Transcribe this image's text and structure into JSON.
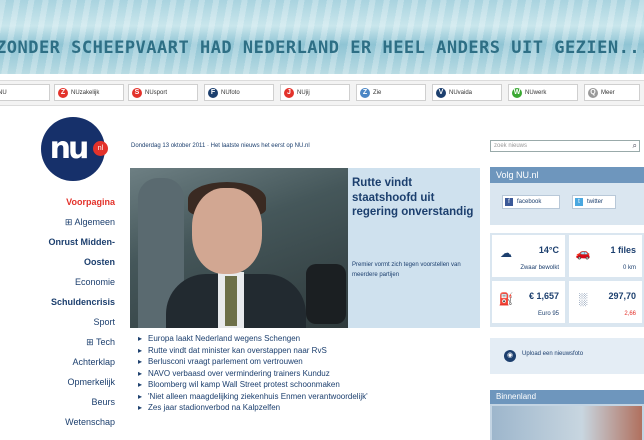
{
  "banner": {
    "text": "ZONDER SCHEEPVAART HAD NEDERLAND ER HEEL ANDERS UIT GEZIEN..."
  },
  "nav": {
    "tabs": [
      {
        "label": "NU",
        "icon": "",
        "color": ""
      },
      {
        "label": "NUzakelijk",
        "icon": "Z",
        "color": "#e3322b"
      },
      {
        "label": "NUsport",
        "icon": "S",
        "color": "#e3322b"
      },
      {
        "label": "NUfoto",
        "icon": "F",
        "color": "#1c3f6e"
      },
      {
        "label": "NUjij",
        "icon": "J",
        "color": "#e3322b"
      },
      {
        "label": "Zie",
        "icon": "Z",
        "color": "#4a86c5"
      },
      {
        "label": "NUvaida",
        "icon": "V",
        "color": "#1c3f6e"
      },
      {
        "label": "NUwerk",
        "icon": "W",
        "color": "#3aa832"
      },
      {
        "label": "Meer",
        "icon": "Q",
        "color": "#999999"
      }
    ]
  },
  "logo": {
    "text": "nu",
    "dot": "nl"
  },
  "sidebar": {
    "items": [
      {
        "label": "Voorpagina",
        "active": true,
        "bold": true
      },
      {
        "label": "⊞ Algemeen",
        "active": false,
        "bold": false
      },
      {
        "label": "Onrust Midden-",
        "active": false,
        "bold": true
      },
      {
        "label": "Oosten",
        "active": false,
        "bold": true
      },
      {
        "label": "Economie",
        "active": false,
        "bold": false
      },
      {
        "label": "Schuldencrisis",
        "active": false,
        "bold": true
      },
      {
        "label": "Sport",
        "active": false,
        "bold": false
      },
      {
        "label": "⊞ Tech",
        "active": false,
        "bold": false
      },
      {
        "label": "Achterklap",
        "active": false,
        "bold": false
      },
      {
        "label": "Opmerkelijk",
        "active": false,
        "bold": false
      },
      {
        "label": "Beurs",
        "active": false,
        "bold": false
      },
      {
        "label": "Wetenschap",
        "active": false,
        "bold": false
      }
    ]
  },
  "date_line": "Donderdag 13 oktober 2011 · Het laatste nieuws het eerst op NU.nl",
  "search": {
    "placeholder": "zoek nieuws"
  },
  "hero": {
    "title": "Rutte vindt staatshoofd uit regering onverstandig",
    "subtitle": "Premier vormt zich tegen voorstellen van meerdere partijen"
  },
  "headlines": [
    "Europa laakt Nederland wegens Schengen",
    "Rutte vindt dat minister kan overstappen naar RvS",
    "Berlusconi vraagt parlement om vertrouwen",
    "NAVO verbaasd over vermindering trainers Kunduz",
    "Bloomberg wil kamp Wall Street protest schoonmaken",
    "'Niet alleen maagdelijking ziekenhuis Enmen verantwoordelijk'",
    "Zes jaar stadionverbod na Kalpzelfen"
  ],
  "volg": {
    "title": "Volg NU.nl",
    "facebook": "facebook",
    "twitter": "twitter"
  },
  "widgets": {
    "weather": {
      "value": "14°C",
      "sub": "Zwaar bewolkt"
    },
    "traffic": {
      "value": "1 files",
      "sub": "0 km"
    },
    "fuel": {
      "value": "€ 1,657",
      "sub": "Euro 95"
    },
    "aex": {
      "value": "297,70",
      "sub": "2,66"
    }
  },
  "upload": {
    "label": "Upload een nieuwsfoto"
  },
  "binnenland": {
    "title": "Binnenland"
  }
}
